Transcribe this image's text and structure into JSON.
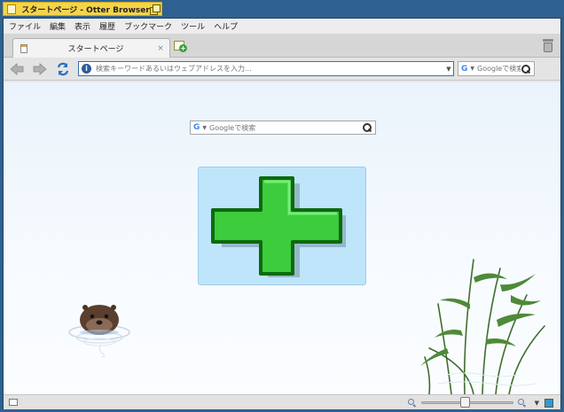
{
  "window": {
    "title": "スタートページ - Otter Browser"
  },
  "menubar": {
    "items": [
      "ファイル",
      "編集",
      "表示",
      "履歴",
      "ブックマーク",
      "ツール",
      "ヘルプ"
    ]
  },
  "tabs": [
    {
      "label": "スタートページ",
      "close": "×"
    }
  ],
  "navigation": {
    "back_icon": "arrow-left-icon",
    "forward_icon": "arrow-right-icon",
    "reload_icon": "reload-icon",
    "address_placeholder": "検索キーワードあるいはウェブアドレスを入力...",
    "search_placeholder": "Googleで検索",
    "search_engine_icon": "G"
  },
  "start_page": {
    "search_placeholder": "Googleで検索",
    "search_engine_icon": "G",
    "add_tile_icon": "add-plus-icon"
  },
  "statusbar": {
    "zoom_fraction": 0.47
  },
  "colors": {
    "title_tab": "#f4d44a",
    "add_cross": "#3ccc3c",
    "tile_background": "#bee5fa"
  }
}
